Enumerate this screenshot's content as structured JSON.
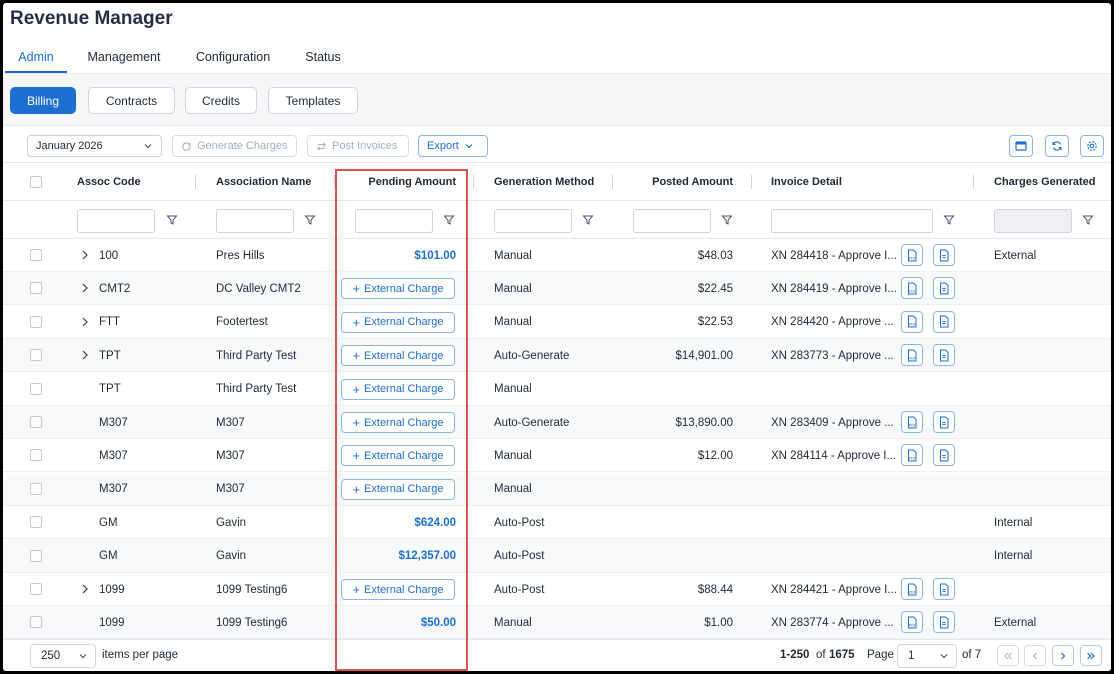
{
  "app": {
    "title": "Revenue Manager"
  },
  "tabs": [
    {
      "label": "Admin",
      "active": true
    },
    {
      "label": "Management"
    },
    {
      "label": "Configuration"
    },
    {
      "label": "Status"
    }
  ],
  "subtabs": [
    {
      "label": "Billing",
      "active": true
    },
    {
      "label": "Contracts"
    },
    {
      "label": "Credits"
    },
    {
      "label": "Templates"
    }
  ],
  "toolbar": {
    "period": "January 2026",
    "generate_label": "Generate Charges",
    "post_label": "Post Invoices",
    "export_label": "Export"
  },
  "columns": {
    "assoc_code": "Assoc Code",
    "association_name": "Association Name",
    "pending_amount": "Pending Amount",
    "generation_method": "Generation Method",
    "posted_amount": "Posted Amount",
    "invoice_detail": "Invoice Detail",
    "charges_generated": "Charges Generated"
  },
  "external_charge_label": "External Charge",
  "rows": [
    {
      "expand": true,
      "code": "100",
      "name": "Pres Hills",
      "pending": "$101.00",
      "method": "Manual",
      "posted": "$48.03",
      "invoice": "XN 284418 - Approve I...",
      "charges": "External"
    },
    {
      "expand": true,
      "code": "CMT2",
      "name": "DC Valley CMT2",
      "pending": "",
      "method": "Manual",
      "posted": "$22.45",
      "invoice": "XN 284419 - Approve I...",
      "charges": ""
    },
    {
      "expand": true,
      "code": "FTT",
      "name": "Footertest",
      "pending": "",
      "method": "Manual",
      "posted": "$22.53",
      "invoice": "XN 284420 - Approve ...",
      "charges": ""
    },
    {
      "expand": true,
      "code": "TPT",
      "name": "Third Party Test",
      "pending": "",
      "method": "Auto-Generate",
      "posted": "$14,901.00",
      "invoice": "XN 283773 - Approve ...",
      "charges": ""
    },
    {
      "expand": false,
      "code": "TPT",
      "name": "Third Party Test",
      "pending": "",
      "method": "Manual",
      "posted": "",
      "invoice": "",
      "charges": ""
    },
    {
      "expand": false,
      "code": "M307",
      "name": "M307",
      "pending": "",
      "method": "Auto-Generate",
      "posted": "$13,890.00",
      "invoice": "XN 283409 - Approve ...",
      "charges": ""
    },
    {
      "expand": false,
      "code": "M307",
      "name": "M307",
      "pending": "",
      "method": "Manual",
      "posted": "$12.00",
      "invoice": "XN 284114 - Approve I...",
      "charges": ""
    },
    {
      "expand": false,
      "code": "M307",
      "name": "M307",
      "pending": "",
      "method": "Manual",
      "posted": "",
      "invoice": "",
      "charges": ""
    },
    {
      "expand": false,
      "code": "GM",
      "name": "Gavin",
      "pending": "$624.00",
      "method": "Auto-Post",
      "posted": "",
      "invoice": "",
      "charges": "Internal"
    },
    {
      "expand": false,
      "code": "GM",
      "name": "Gavin",
      "pending": "$12,357.00",
      "method": "Auto-Post",
      "posted": "",
      "invoice": "",
      "charges": "Internal"
    },
    {
      "expand": true,
      "code": "1099",
      "name": "1099 Testing6",
      "pending": "",
      "method": "Auto-Post",
      "posted": "$88.44",
      "invoice": "XN 284421 - Approve I...",
      "charges": ""
    },
    {
      "expand": false,
      "code": "1099",
      "name": "1099 Testing6",
      "pending": "$50.00",
      "method": "Manual",
      "posted": "$1.00",
      "invoice": "XN 283774 - Approve ...",
      "charges": "External"
    }
  ],
  "footer": {
    "page_size": "250",
    "items_per_page_label": "items per page",
    "range": "1-250",
    "of_label": "of",
    "total": "1675",
    "page_label": "Page",
    "page": "1",
    "pages_label": "of 7"
  },
  "colors": {
    "accent": "#1c6fd1",
    "highlight": "#d9534f"
  }
}
